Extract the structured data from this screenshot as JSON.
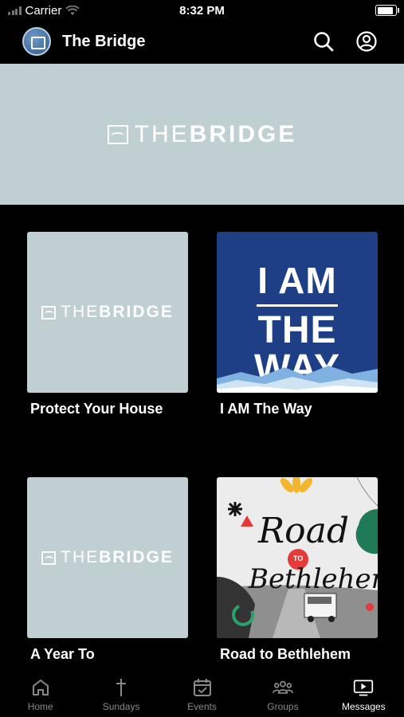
{
  "status": {
    "carrier": "Carrier",
    "time": "8:32 PM",
    "battery_level": 1.0
  },
  "header": {
    "title": "The Bridge"
  },
  "banner": {
    "brand_thin": "THE",
    "brand_bold": "BRIDGE"
  },
  "messages": [
    {
      "title": "Protect Your House",
      "art": "brand-placeholder"
    },
    {
      "title": "I AM The Way",
      "art": "i-am-the-way",
      "art_line1": "I AM",
      "art_line2": "THE WAY",
      "art_color": "#1e3e86"
    },
    {
      "title": "A Year To",
      "art": "brand-placeholder"
    },
    {
      "title": "Road to Bethlehem",
      "art": "road-to-bethlehem",
      "art_line1": "Road",
      "art_badge": "TO",
      "art_line2": "Bethlehem"
    }
  ],
  "brand_thin": "THE",
  "brand_bold": "BRIDGE",
  "tabs": [
    {
      "label": "Home",
      "icon": "home-icon",
      "active": false
    },
    {
      "label": "Sundays",
      "icon": "cross-icon",
      "active": false
    },
    {
      "label": "Events",
      "icon": "calendar-check-icon",
      "active": false
    },
    {
      "label": "Groups",
      "icon": "group-icon",
      "active": false
    },
    {
      "label": "Messages",
      "icon": "tv-play-icon",
      "active": true
    }
  ]
}
